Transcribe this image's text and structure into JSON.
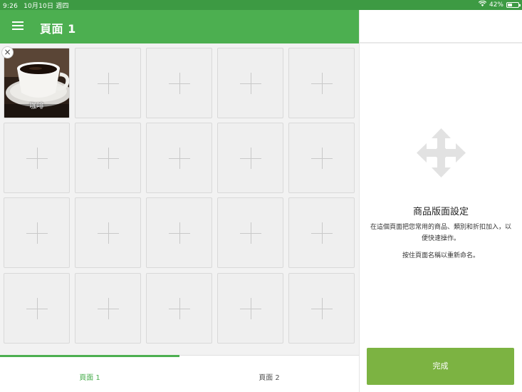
{
  "status_bar": {
    "time": "9:26",
    "date": "10月10日 週四",
    "battery": "42%",
    "battery_level": 0.42
  },
  "header": {
    "title": "頁面 1"
  },
  "grid": {
    "item_name": "咖啡"
  },
  "tabs": [
    {
      "label": "頁面 1"
    },
    {
      "label": "頁面 2"
    }
  ],
  "panel": {
    "title": "商品版面設定",
    "description": "在這個頁面把您常用的商品、類別和折扣加入，以便快速操作。",
    "hint": "按住頁面名稱以重新命名。",
    "done_label": "完成"
  },
  "colors": {
    "primary": "#4caf50",
    "status_bar": "#3d9a43",
    "done_button": "#7cb342"
  }
}
